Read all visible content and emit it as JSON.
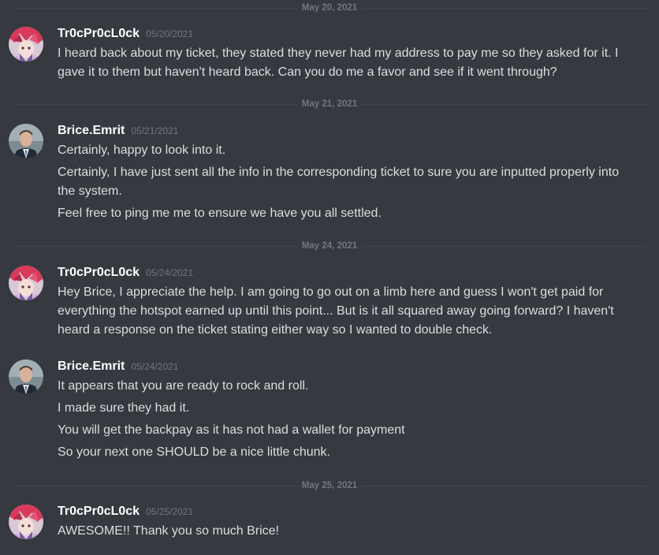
{
  "dividers": [
    "May 20, 2021",
    "May 21, 2021",
    "May 24, 2021",
    "May 25, 2021"
  ],
  "messages": [
    {
      "username": "Tr0cPr0cL0ck",
      "avatar": "anime-avatar",
      "timestamp": "05/20/2021",
      "lines": [
        "I heard back about my ticket, they stated they never had my address to pay me so they asked for it. I gave it to them but haven't heard back. Can you do me a favor and see if it went through?"
      ]
    },
    {
      "username": "Brice.Emrit",
      "avatar": "person-avatar",
      "timestamp": "05/21/2021",
      "lines": [
        "Certainly, happy to look into it.",
        "Certainly, I have just sent all the info in the corresponding ticket to sure you are inputted properly into the system.",
        "Feel free to ping me me to ensure we have you all settled."
      ]
    },
    {
      "username": "Tr0cPr0cL0ck",
      "avatar": "anime-avatar",
      "timestamp": "05/24/2021",
      "lines": [
        "Hey Brice, I appreciate the help. I am going to go out on a limb here and guess I won't get paid for everything the hotspot earned up until this point... But is it all squared away going forward? I haven't heard a response on the ticket stating either way so I wanted to double check."
      ]
    },
    {
      "username": "Brice.Emrit",
      "avatar": "person-avatar",
      "timestamp": "05/24/2021",
      "lines": [
        "It appears that you are ready to rock and roll.",
        "I made sure they had it.",
        "You will get the backpay as it has not had a wallet for payment",
        "So your next one SHOULD be a nice little chunk."
      ]
    },
    {
      "username": "Tr0cPr0cL0ck",
      "avatar": "anime-avatar",
      "timestamp": "05/25/2021",
      "lines": [
        "AWESOME!! Thank you so much Brice!"
      ]
    }
  ]
}
